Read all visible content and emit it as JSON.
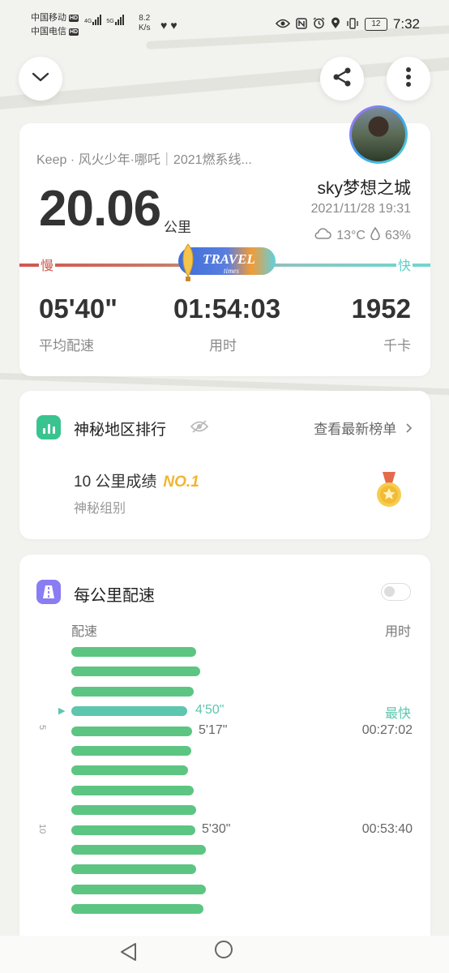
{
  "status_bar": {
    "carrier1": "中国移动",
    "carrier2": "中国电信",
    "hd": "HD",
    "net1": "4G",
    "net2": "5G",
    "speed_value": "8.2",
    "speed_unit": "K/s",
    "battery": "12",
    "time": "7:32"
  },
  "workout": {
    "subtitle": "Keep · 风火少年·哪吒｜2021燃系线...",
    "distance": "20.06",
    "distance_unit": "公里",
    "username": "sky梦想之城",
    "datetime": "2021/11/28 19:31",
    "temperature": "13°C",
    "humidity": "63%",
    "slow_label": "慢",
    "fast_label": "快",
    "logo_text": "TRAVEL",
    "logo_sub": "times",
    "stats": [
      {
        "value": "05'40\"",
        "label": "平均配速"
      },
      {
        "value": "01:54:03",
        "label": "用时"
      },
      {
        "value": "1952",
        "label": "千卡"
      }
    ]
  },
  "ranking": {
    "title": "神秘地区排行",
    "link": "查看最新榜单",
    "score_label": "10 公里成绩",
    "rank": "NO.1",
    "group": "神秘组别"
  },
  "splits": {
    "title": "每公里配速",
    "col_pace": "配速",
    "col_time": "用时",
    "fastest_label": "最快",
    "axis_labels": [
      "5",
      "10"
    ],
    "bars": [
      {
        "km": 1,
        "rel": 0.93
      },
      {
        "km": 2,
        "rel": 0.96
      },
      {
        "km": 3,
        "rel": 0.91
      },
      {
        "km": 4,
        "rel": 0.86,
        "pace": "4'50\"",
        "fastest": true
      },
      {
        "km": 5,
        "rel": 0.9,
        "pace": "5'17\"",
        "time": "00:27:02"
      },
      {
        "km": 6,
        "rel": 0.89
      },
      {
        "km": 7,
        "rel": 0.87
      },
      {
        "km": 8,
        "rel": 0.91
      },
      {
        "km": 9,
        "rel": 0.93
      },
      {
        "km": 10,
        "rel": 0.92,
        "pace": "5'30\"",
        "time": "00:53:40"
      },
      {
        "km": 11,
        "rel": 1.0
      },
      {
        "km": 12,
        "rel": 0.93
      },
      {
        "km": 13,
        "rel": 1.0
      },
      {
        "km": 14,
        "rel": 0.98
      }
    ]
  }
}
